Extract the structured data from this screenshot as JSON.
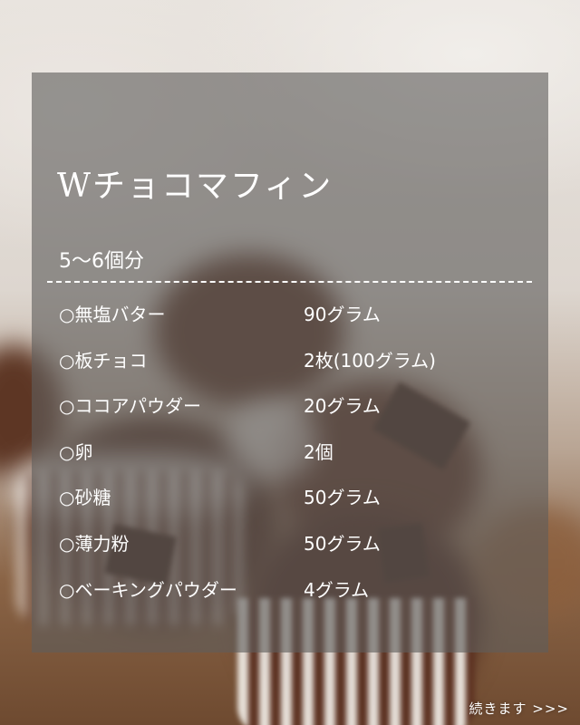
{
  "recipe": {
    "title": "Wチョコマフィン",
    "servings": "5〜6個分",
    "ingredients": [
      {
        "name": "○無塩バター",
        "amount": "90グラム"
      },
      {
        "name": "○板チョコ",
        "amount": "2枚(100グラム)"
      },
      {
        "name": "○ココアパウダー",
        "amount": "20グラム"
      },
      {
        "name": "○卵",
        "amount": "2個"
      },
      {
        "name": "○砂糖",
        "amount": "50グラム"
      },
      {
        "name": "○薄力粉",
        "amount": "50グラム"
      },
      {
        "name": "○ベーキングパウダー",
        "amount": "4グラム"
      }
    ]
  },
  "footer": {
    "continue_label": "続きます >>>"
  }
}
